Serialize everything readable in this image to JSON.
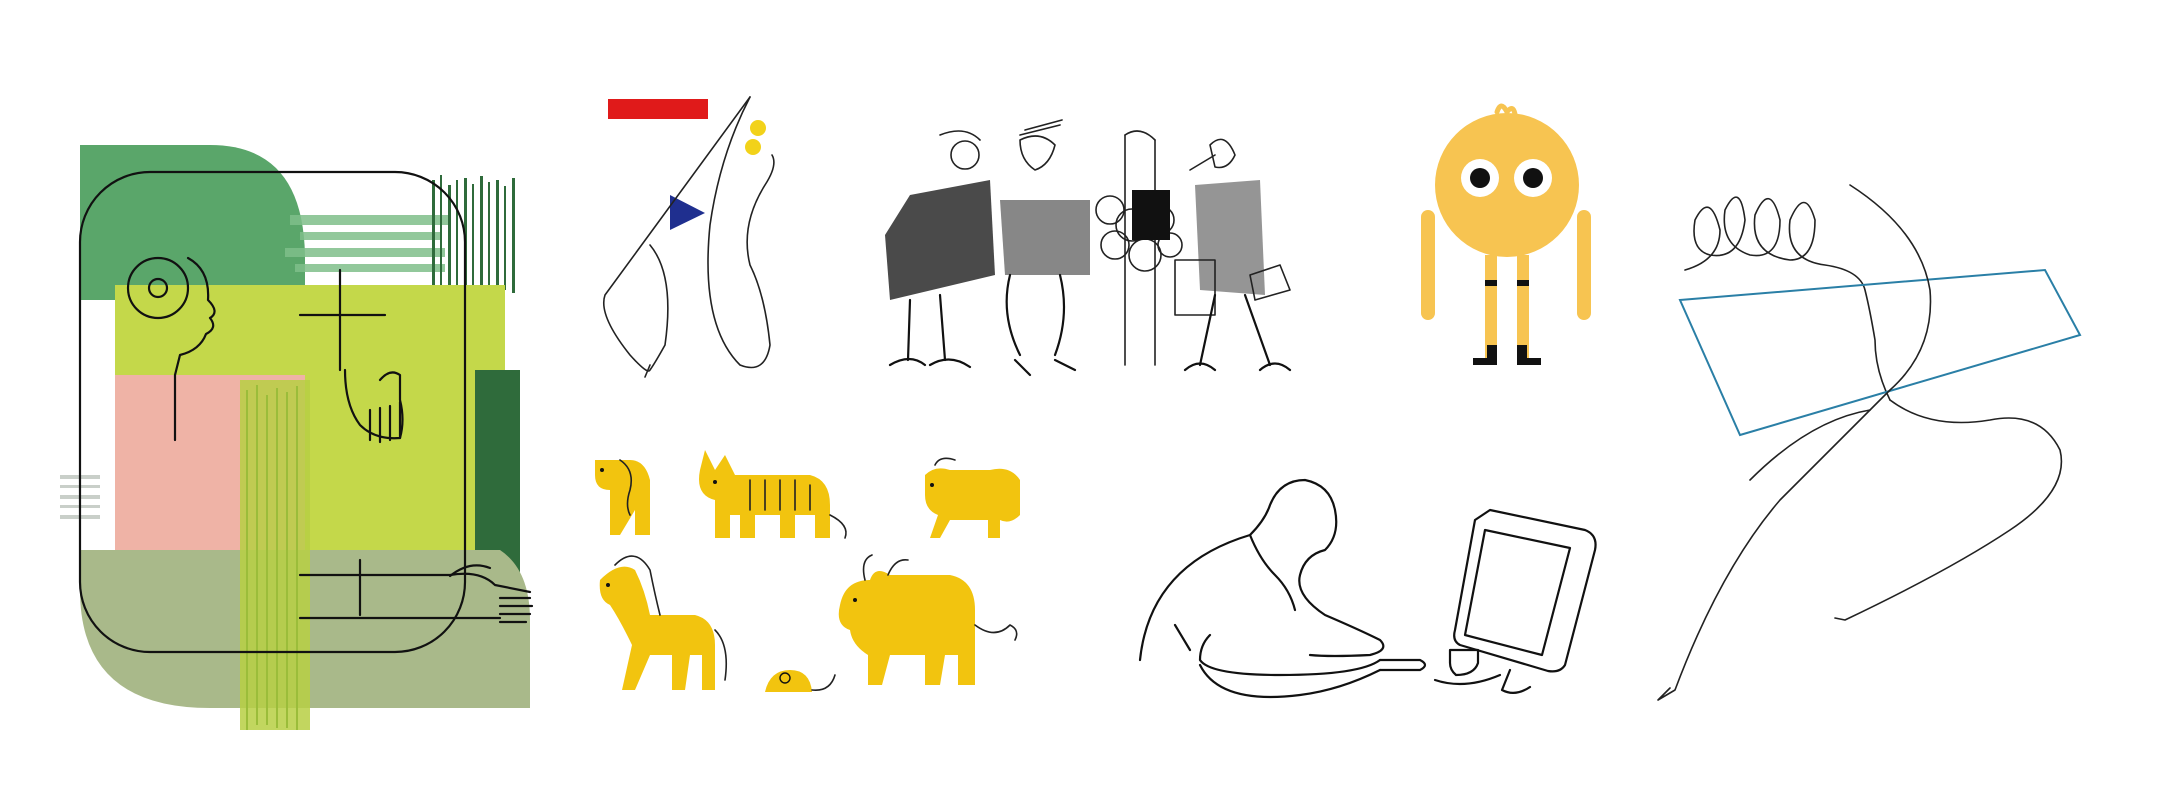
{
  "page": {
    "background": "#ffffff"
  },
  "palette": {
    "green_dark": "#2f6b3b",
    "green_mid": "#5aa66a",
    "lime": "#c4d84a",
    "pink": "#efb3a6",
    "sage": "#a9b98a",
    "red": "#e01a1a",
    "navy": "#1f2f8f",
    "yellow": "#f2c40f",
    "chick_yellow": "#f7c451",
    "teal_line": "#2a7fa6",
    "ink": "#111111"
  },
  "illustrations": [
    {
      "id": "abstract-face-collage",
      "icon": "collage-face-hands-icon"
    },
    {
      "id": "abstract-figure-shapes",
      "icon": "line-figure-icon"
    },
    {
      "id": "people-group-sketch",
      "icon": "crowd-sketch-icon"
    },
    {
      "id": "yellow-chick-character",
      "icon": "chick-character-icon"
    },
    {
      "id": "scribble-runner",
      "icon": "scribble-figure-icon"
    },
    {
      "id": "zodiac-animals",
      "icon": "animals-icon"
    },
    {
      "id": "person-at-computer",
      "icon": "computer-user-icon"
    }
  ]
}
